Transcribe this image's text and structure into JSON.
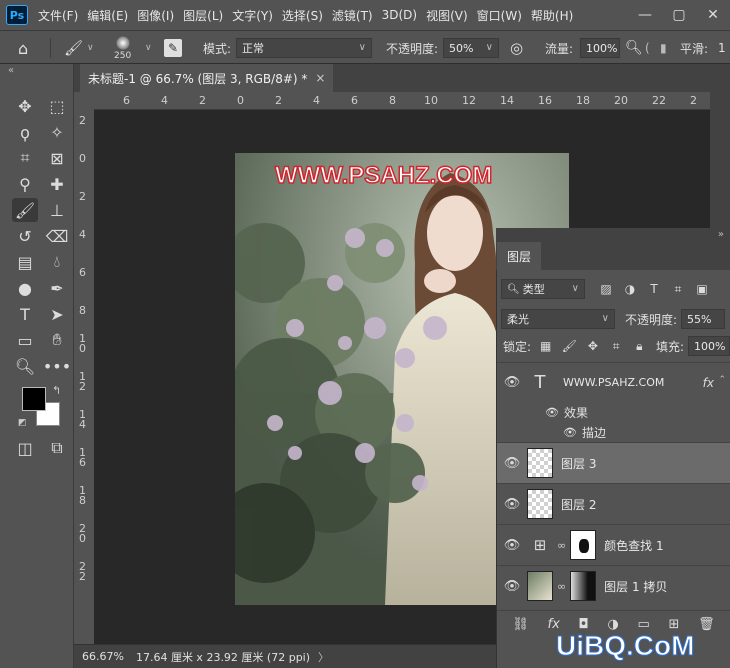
{
  "app": {
    "logo": "Ps",
    "menu": [
      "文件(F)",
      "编辑(E)",
      "图像(I)",
      "图层(L)",
      "文字(Y)",
      "选择(S)",
      "滤镜(T)",
      "3D(D)",
      "视图(V)",
      "窗口(W)",
      "帮助(H)"
    ],
    "window_controls": {
      "minimize": "—",
      "maximize": "▢",
      "close": "✕"
    }
  },
  "options": {
    "brush_size": "250",
    "mode_label": "模式:",
    "mode_value": "正常",
    "opacity_label": "不透明度:",
    "opacity_value": "50%",
    "flow_label": "流量:",
    "flow_value": "100%",
    "smoothing_label": "平滑:",
    "smoothing_value": "1"
  },
  "document": {
    "tab_title": "未标题-1 @ 66.7% (图层 3, RGB/8#) *",
    "tab_close": "×",
    "watermark": "WWW.PSAHZ.COM"
  },
  "rulers": {
    "h": [
      "6",
      "4",
      "2",
      "0",
      "2",
      "4",
      "6",
      "8",
      "10",
      "12",
      "14",
      "16",
      "18",
      "20",
      "22",
      "2"
    ],
    "v": [
      "2",
      "0",
      "2",
      "4",
      "6",
      "8",
      "1 0",
      "1 2",
      "1 4",
      "1 6",
      "1 8",
      "2 0",
      "2 2"
    ]
  },
  "status": {
    "zoom": "66.67%",
    "doc_info": "17.64 厘米 x 23.92 厘米 (72 ppi)",
    "arrow": "〉"
  },
  "layers_panel": {
    "tab": "图层",
    "filter_label": "类型",
    "blend_mode": "柔光",
    "opacity_label": "不透明度:",
    "opacity_value": "55%",
    "lock_label": "锁定:",
    "fill_label": "填充:",
    "fill_value": "100%",
    "layers": [
      {
        "name": "WWW.PSAHZ.COM",
        "kind": "text",
        "fx": "fx"
      },
      {
        "name": "效果",
        "kind": "effects-group"
      },
      {
        "name": "描边",
        "kind": "effect"
      },
      {
        "name": "图层 3",
        "kind": "pixel",
        "selected": true
      },
      {
        "name": "图层 2",
        "kind": "pixel"
      },
      {
        "name": "颜色查找 1",
        "kind": "adjustment"
      },
      {
        "name": "图层 1 拷贝",
        "kind": "pixel-mask"
      }
    ]
  },
  "site_watermark": "UiBQ.CoM",
  "colors": {
    "ui_dark": "#535353",
    "canvas_bg": "#282828",
    "selected_layer": "#6b6b6b",
    "watermark_stroke": "#d0262e",
    "accent": "#31a8ff"
  }
}
